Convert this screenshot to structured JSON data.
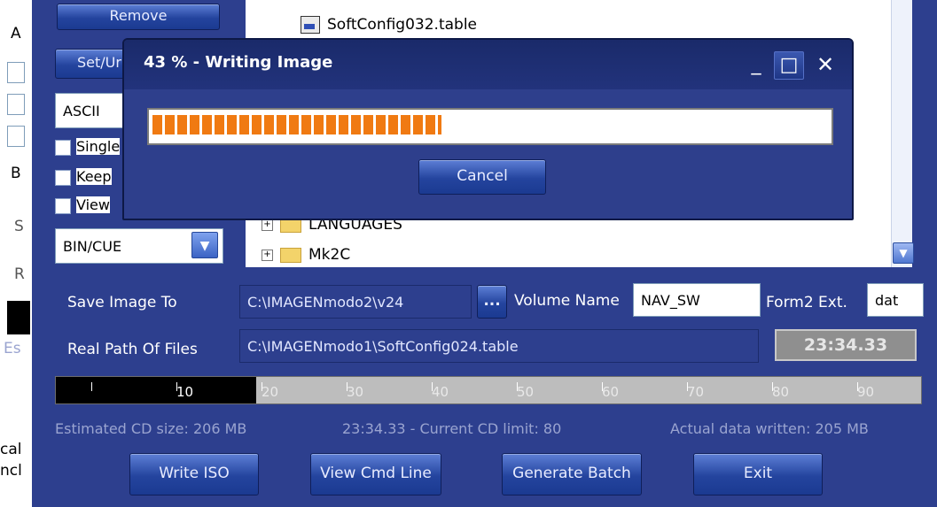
{
  "left_strip": {
    "fragments": [
      "A",
      "B",
      "S",
      "R",
      "Es",
      "cal",
      "ncl"
    ]
  },
  "panel": {
    "remove_button": "Remove",
    "set_button": "Set/Ur",
    "format_select": "ASCII",
    "checkboxes": [
      "Single",
      "Keep",
      "View"
    ],
    "image_format": "BIN/CUE"
  },
  "tree": {
    "items": [
      "SoftConfig032.table",
      "LANGUAGES",
      "Mk2C"
    ]
  },
  "save_image_label": "Save Image To",
  "save_image_path": "C:\\IMAGENmodo2\\v24",
  "browse_button": "...",
  "volume_name_label": "Volume Name",
  "volume_name_value": "NAV_SW",
  "form2_label": "Form2 Ext.",
  "form2_value": "dat",
  "real_path_label": "Real Path Of Files",
  "real_path_value": "C:\\IMAGENmodo1\\SoftConfig024.table",
  "time_display": "23:34.33",
  "ruler": {
    "labels": [
      "10",
      "20",
      "30",
      "40",
      "50",
      "60",
      "70",
      "80",
      "90"
    ],
    "filled_to": 20
  },
  "status": {
    "estimated": "Estimated CD size: 206 MB",
    "limit": "23:34.33 - Current CD limit: 80",
    "actual": "Actual data written: 205 MB"
  },
  "buttons": {
    "write_iso": "Write ISO",
    "view_cmd": "View Cmd Line",
    "generate_batch": "Generate Batch",
    "exit": "Exit"
  },
  "dialog": {
    "title": "43 % - Writing Image",
    "progress_percent": 43,
    "cancel_button": "Cancel",
    "minimize": "_",
    "maximize": "□",
    "close": "✕"
  },
  "colors": {
    "window_blue": "#2d3f8e",
    "progress_orange": "#f07a12",
    "button_blue": "#24449e"
  }
}
